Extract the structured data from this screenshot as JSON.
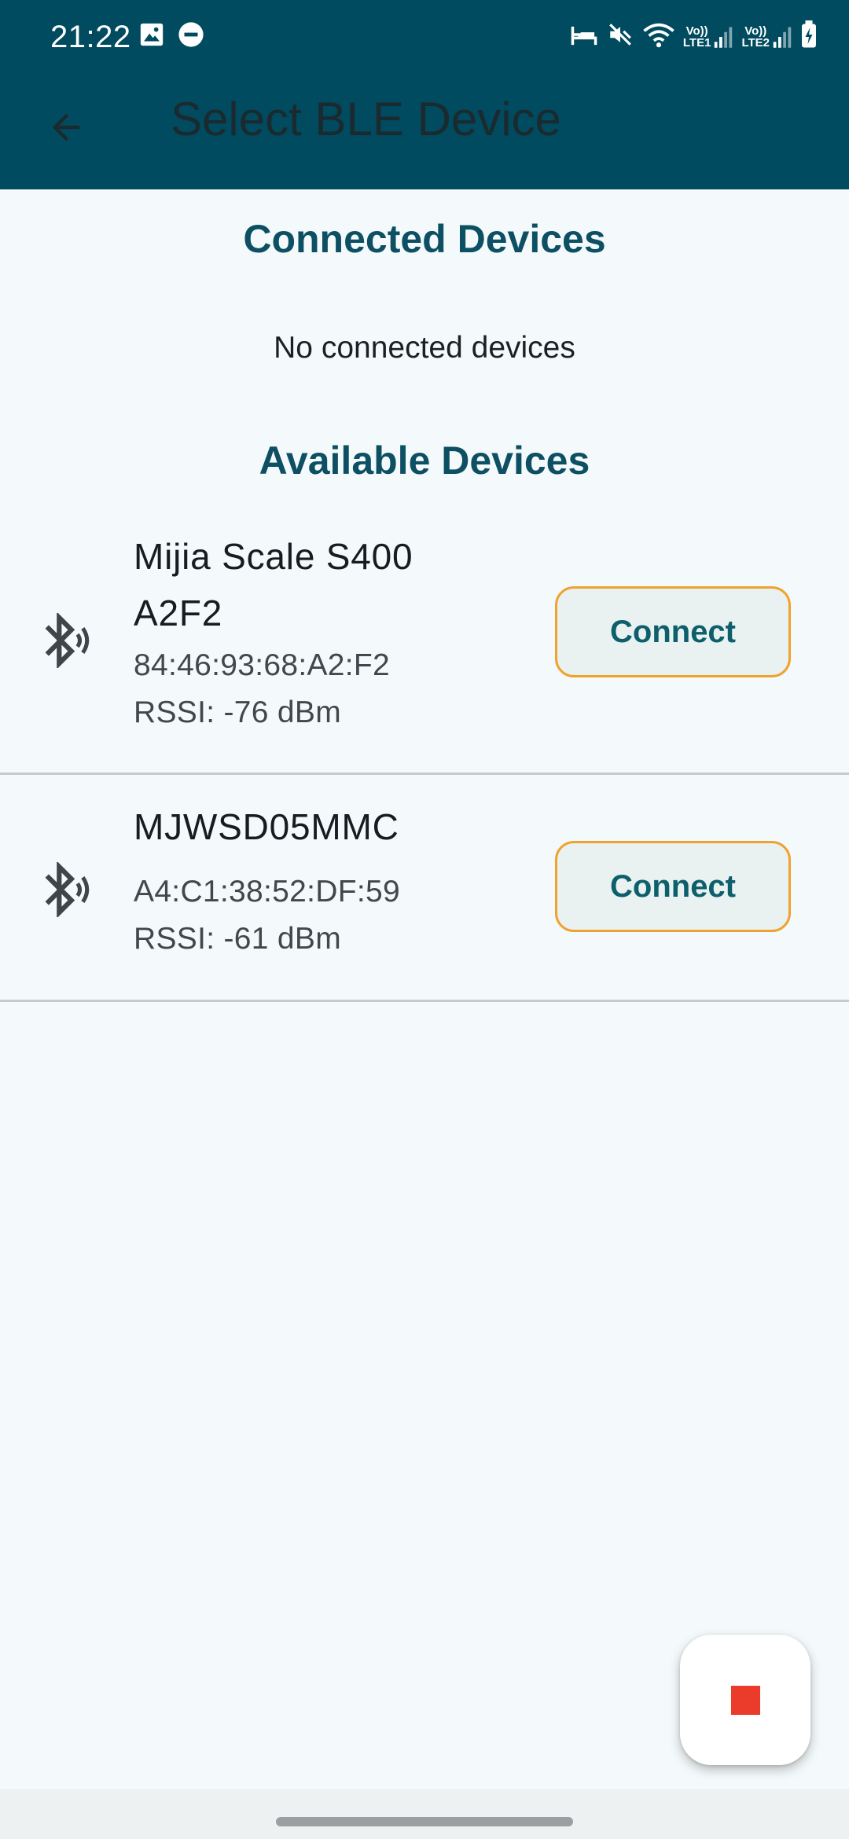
{
  "status_bar": {
    "time": "21:22",
    "left_icons": [
      "image-icon",
      "do-not-disturb-icon"
    ],
    "right_icons": [
      "sleep-mode-icon",
      "mute-icon",
      "wifi-icon",
      "signal-sim1-icon",
      "signal-sim2-icon",
      "battery-charging-icon"
    ],
    "sim1_label": "Vo))",
    "sim1_net": "LTE1",
    "sim2_label": "Vo))",
    "sim2_net": "LTE2"
  },
  "appbar": {
    "back_icon": "arrow-back-icon",
    "title": "Select BLE Device"
  },
  "connected": {
    "title": "Connected Devices",
    "empty_message": "No connected devices"
  },
  "available": {
    "title": "Available Devices",
    "devices": [
      {
        "icon": "bluetooth-searching-icon",
        "name_line1": "Mijia Scale S400",
        "name_line2": "A2F2",
        "mac": "84:46:93:68:A2:F2",
        "rssi": "RSSI: -76 dBm",
        "button_label": "Connect"
      },
      {
        "icon": "bluetooth-searching-icon",
        "name_line1": "MJWSD05MMC",
        "mac": "A4:C1:38:52:DF:59",
        "rssi": "RSSI: -61 dBm",
        "button_label": "Connect"
      }
    ]
  },
  "fab": {
    "icon": "stop-icon"
  },
  "colors": {
    "appbar": "#004b5f",
    "background": "#f4fafb",
    "section_title": "#0d4f63",
    "button_border": "#f0a22e",
    "button_text": "#0c5f6b",
    "stop": "#ea3b2b"
  }
}
